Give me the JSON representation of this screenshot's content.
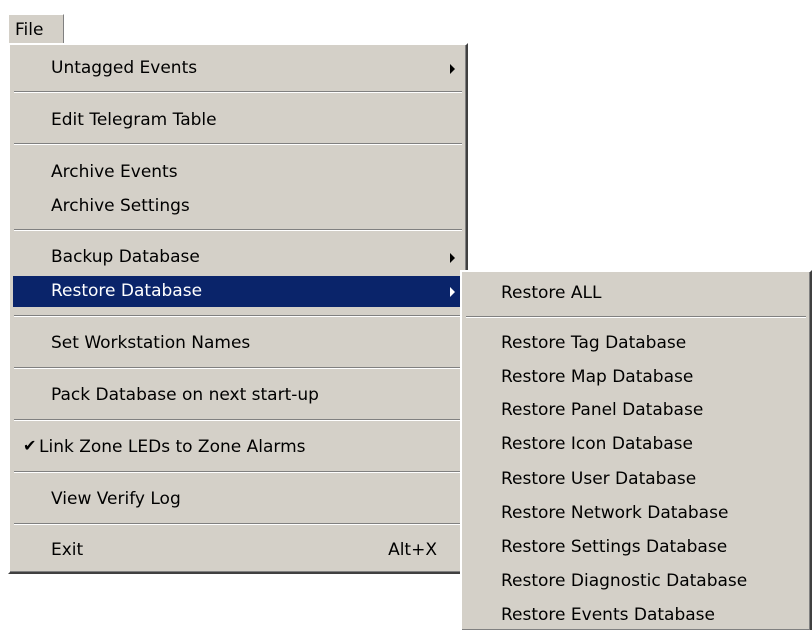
{
  "menubar": {
    "file_label": "File"
  },
  "file_menu": {
    "untagged_events": "Untagged Events",
    "edit_telegram_table": "Edit Telegram Table",
    "archive_events": "Archive Events",
    "archive_settings": "Archive Settings",
    "backup_database": "Backup Database",
    "restore_database": "Restore Database",
    "set_workstation_names": "Set Workstation Names",
    "pack_database": "Pack Database on next start-up",
    "link_zone_leds": "Link Zone LEDs to Zone Alarms",
    "link_zone_leds_checked": true,
    "check_glyph": "✔",
    "view_verify_log": "View Verify Log",
    "exit": "Exit",
    "exit_shortcut": "Alt+X"
  },
  "restore_submenu": {
    "restore_all": "Restore ALL",
    "items": [
      "Restore Tag Database",
      "Restore Map Database",
      "Restore Panel Database",
      "Restore Icon Database",
      "Restore User Database",
      "Restore Network Database",
      "Restore Settings Database",
      "Restore Diagnostic Database",
      "Restore Events Database"
    ]
  },
  "colors": {
    "menu_bg": "#d4d0c8",
    "highlight_bg": "#0a246a",
    "highlight_text": "#ffffff"
  }
}
